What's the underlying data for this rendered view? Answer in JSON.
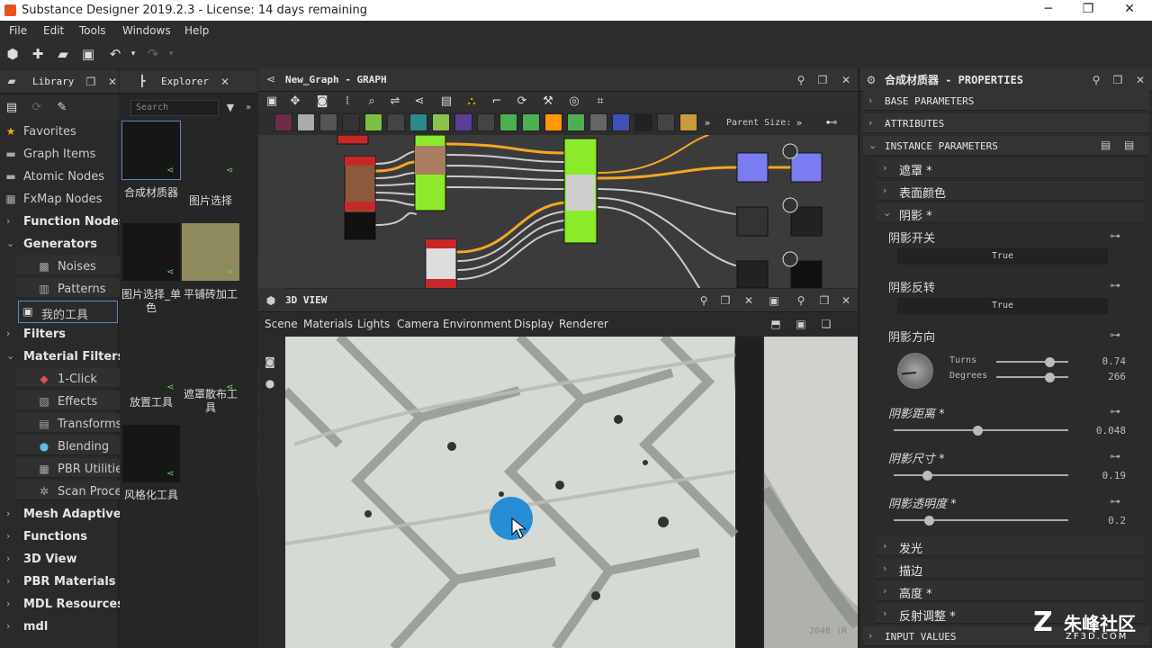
{
  "window": {
    "title": "Substance Designer 2019.2.3 - License: 14 days remaining"
  },
  "menu": [
    "File",
    "Edit",
    "Tools",
    "Windows",
    "Help"
  ],
  "library": {
    "tab_library": "Library",
    "tab_explorer": "Explorer",
    "search_placeholder": "Search",
    "items": [
      {
        "label": "Favorites",
        "icon": "star-icon"
      },
      {
        "label": "Graph Items",
        "icon": "graph-items-icon"
      },
      {
        "label": "Atomic Nodes",
        "icon": "atomic-nodes-icon"
      },
      {
        "label": "FxMap Nodes",
        "icon": "fxmap-icon"
      },
      {
        "label": "Function Nodes"
      },
      {
        "label": "Generators"
      },
      {
        "label": "Noises",
        "icon": "noise-icon"
      },
      {
        "label": "Patterns",
        "icon": "pattern-icon"
      },
      {
        "label": "我的工具",
        "icon": "my-tools-icon"
      },
      {
        "label": "Filters"
      },
      {
        "label": "Material Filters"
      },
      {
        "label": "1-Click",
        "icon": "one-click-icon"
      },
      {
        "label": "Effects",
        "icon": "effects-icon"
      },
      {
        "label": "Transforms",
        "icon": "transforms-icon"
      },
      {
        "label": "Blending",
        "icon": "blending-icon"
      },
      {
        "label": "PBR Utilities",
        "icon": "pbr-utilities-icon"
      },
      {
        "label": "Scan Proces..."
      },
      {
        "label": "Mesh Adaptive"
      },
      {
        "label": "Functions"
      },
      {
        "label": "3D View"
      },
      {
        "label": "PBR Materials"
      },
      {
        "label": "MDL Resources"
      },
      {
        "label": "mdl"
      }
    ]
  },
  "explorer_tiles": [
    {
      "label": "合成材质器"
    },
    {
      "label": "图片选择"
    },
    {
      "label": "图片选择_单色"
    },
    {
      "label": "平铺砖加工"
    },
    {
      "label": "放置工具"
    },
    {
      "label": "遮罩散布工具"
    },
    {
      "label": "风格化工具"
    }
  ],
  "graph": {
    "title": "New_Graph - GRAPH",
    "parent_size_label": "Parent Size:"
  },
  "view3d": {
    "title": "3D VIEW",
    "menu": [
      "Scene",
      "Materials",
      "Lights",
      "Camera",
      "Environment",
      "Display",
      "Renderer"
    ]
  },
  "view2d": {
    "footer": "2048 (R"
  },
  "properties": {
    "title": "合成材质器 - PROPERTIES",
    "sections": {
      "base": "BASE PARAMETERS",
      "attributes": "ATTRIBUTES",
      "instance": "INSTANCE PARAMETERS",
      "input_values": "INPUT VALUES"
    },
    "groups": {
      "mask": "遮罩 *",
      "surface_color": "表面颜色",
      "shadow": "阴影 *",
      "glow": "发光",
      "stroke": "描边",
      "height": "高度 *",
      "reflection": "反射调整 *"
    },
    "params": {
      "shadow_switch_label": "阴影开关",
      "shadow_switch_value": "True",
      "shadow_invert_label": "阴影反转",
      "shadow_invert_value": "True",
      "shadow_direction_label": "阴影方向",
      "turns_label": "Turns",
      "turns_value": "0.74",
      "degrees_label": "Degrees",
      "degrees_value": "266",
      "shadow_distance_label": "阴影距离 *",
      "shadow_distance_value": "0.048",
      "shadow_size_label": "阴影尺寸 *",
      "shadow_size_value": "0.19",
      "shadow_opacity_label": "阴影透明度 *",
      "shadow_opacity_value": "0.2",
      "turns_fraction": 0.74,
      "degrees_fraction": 0.74,
      "distance_fraction": 0.48,
      "size_fraction": 0.19,
      "opacity_fraction": 0.2
    }
  },
  "watermark": {
    "brand": "朱峰社区",
    "url": "ZF3D.COM"
  }
}
